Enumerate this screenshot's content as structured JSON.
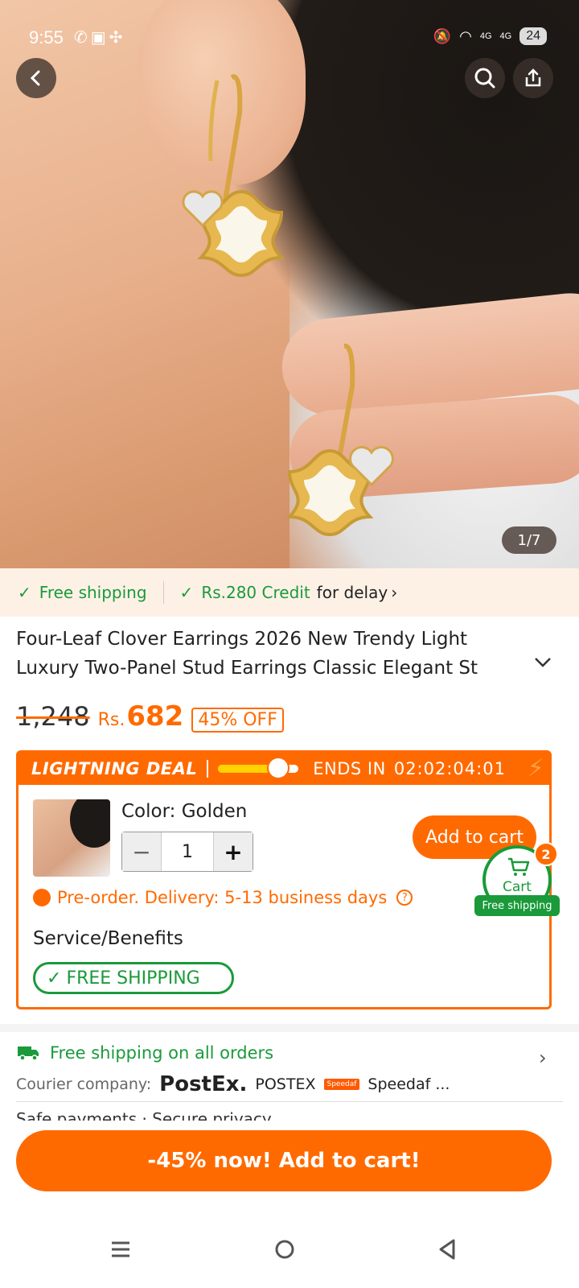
{
  "status_bar": {
    "time": "9:55",
    "battery": "24",
    "left_icons": [
      "whatsapp-icon",
      "sim-icon",
      "pinwheel-icon"
    ],
    "right_icons": [
      "mute-icon",
      "wifi-icon",
      "4g-signal-icon",
      "4g-signal-icon"
    ],
    "net_label_1": "4G",
    "net_label_2": "4G"
  },
  "hero": {
    "image_counter": "1/7"
  },
  "shipping_strip": {
    "free_shipping": "Free shipping",
    "credit_amount": "Rs.280 Credit",
    "credit_suffix": "for delay",
    "chevron": "›"
  },
  "product": {
    "title": "Four-Leaf Clover Earrings 2026 New Trendy Light Luxury Two-Panel Stud Earrings Classic Elegant St",
    "old_price": "1,248",
    "currency": "Rs.",
    "new_price": "682",
    "discount": "45% OFF"
  },
  "deal": {
    "label": "LIGHTNING DEAL",
    "ends_in_label": "ENDS IN",
    "countdown": "02:02:04:01",
    "progress": 0.75,
    "color_label": "Color: Golden",
    "quantity": "1",
    "minus": "−",
    "plus": "+",
    "add_to_cart": "Add to cart",
    "preorder": "Pre-order. Delivery: 5-13 business days",
    "help": "?",
    "service_title": "Service/Benefits",
    "free_shipping_badge": "FREE SHIPPING"
  },
  "cart_float": {
    "label": "Cart",
    "count": "2",
    "shipping": "Free shipping"
  },
  "shipping_info": {
    "line": "Free shipping on all orders",
    "courier_label": "Courier company:",
    "postex_logo": "PostEx.",
    "postex_name": "POSTEX",
    "speedaf_logo": "Speedaf",
    "speedaf_name": "Speedaf ...",
    "next_row": "Safe payments · Secure privacy"
  },
  "cta": {
    "label": "-45% now! Add to cart!"
  },
  "colors": {
    "accent": "#ff6a00",
    "green": "#1a9a3a"
  }
}
